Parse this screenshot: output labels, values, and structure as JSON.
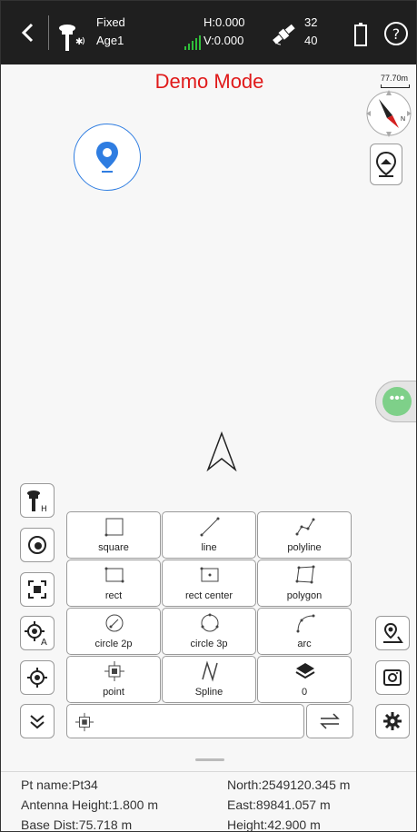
{
  "status": {
    "fix": "Fixed",
    "age": "Age1",
    "h": "H:0.000",
    "v": "V:0.000",
    "sats_used": "32",
    "sats_total": "40"
  },
  "demo_label": "Demo Mode",
  "compass": {
    "scale": "77.70m",
    "dir": "N"
  },
  "tools": [
    {
      "label": "square",
      "icon": "square-icon"
    },
    {
      "label": "line",
      "icon": "line-icon"
    },
    {
      "label": "polyline",
      "icon": "polyline-icon"
    },
    {
      "label": "rect",
      "icon": "rect-icon"
    },
    {
      "label": "rect center",
      "icon": "rect-center-icon"
    },
    {
      "label": "polygon",
      "icon": "polygon-icon"
    },
    {
      "label": "circle 2p",
      "icon": "circle-2p-icon"
    },
    {
      "label": "circle 3p",
      "icon": "circle-3p-icon"
    },
    {
      "label": "arc",
      "icon": "arc-icon"
    },
    {
      "label": "point",
      "icon": "point-icon"
    },
    {
      "label": "Spline",
      "icon": "spline-icon"
    },
    {
      "label": "0",
      "icon": "layers-icon"
    }
  ],
  "info": {
    "pt_name": "Pt name:Pt34",
    "antenna_height": "Antenna Height:1.800 m",
    "base_dist": "Base Dist:75.718 m",
    "north": "North:2549120.345 m",
    "east": "East:89841.057 m",
    "height": "Height:42.900 m"
  },
  "colors": {
    "accent": "#2f7de1",
    "demo": "#e01a1a",
    "fab": "#7ed089",
    "signal": "#2fbf3a"
  }
}
